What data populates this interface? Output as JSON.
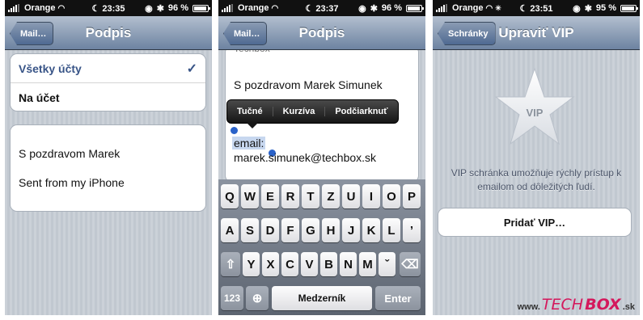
{
  "status": {
    "carrier": "Orange",
    "battery_1": "96 %",
    "battery_2": "96 %",
    "battery_3": "95 %",
    "time_1": "23:35",
    "time_2": "23:37",
    "time_3": "23:51"
  },
  "screen1": {
    "back_label": "Mail…",
    "title": "Podpis",
    "options": [
      {
        "label": "Všetky účty",
        "selected": true
      },
      {
        "label": "Na účet",
        "selected": false
      }
    ],
    "signature_line1": "S pozdravom Marek",
    "signature_line2": "Sent from my iPhone"
  },
  "screen2": {
    "back_label": "Mail…",
    "title": "Podpis",
    "text_partial_top": "Techbox",
    "text_line1": "S pozdravom Marek Simunek",
    "selected_word": "email:",
    "text_line3": "marek.simunek@techbox.sk",
    "edit_menu": [
      "Tučné",
      "Kurzíva",
      "Podčiarknuť"
    ],
    "keyboard": {
      "row1": [
        "Q",
        "W",
        "E",
        "R",
        "T",
        "Z",
        "U",
        "I",
        "O",
        "P"
      ],
      "row2": [
        "A",
        "S",
        "D",
        "F",
        "G",
        "H",
        "J",
        "K",
        "L"
      ],
      "row3": [
        "Y",
        "X",
        "C",
        "V",
        "B",
        "N",
        "M"
      ],
      "apostrophe": "ˇ",
      "numbers_key": "123",
      "space_key": "Medzerník",
      "enter_key": "Enter"
    }
  },
  "screen3": {
    "back_label": "Schránky",
    "title": "Upraviť VIP",
    "star_label": "VIP",
    "description": "VIP schránka umožňuje rýchly prístup k emailom od dôležitých ľudí.",
    "add_button": "Pridať VIP…"
  },
  "watermark": {
    "prefix": "www.",
    "part1": "TECH",
    "part2": "BOX",
    "suffix": ".sk",
    "color": "#d4185c"
  }
}
